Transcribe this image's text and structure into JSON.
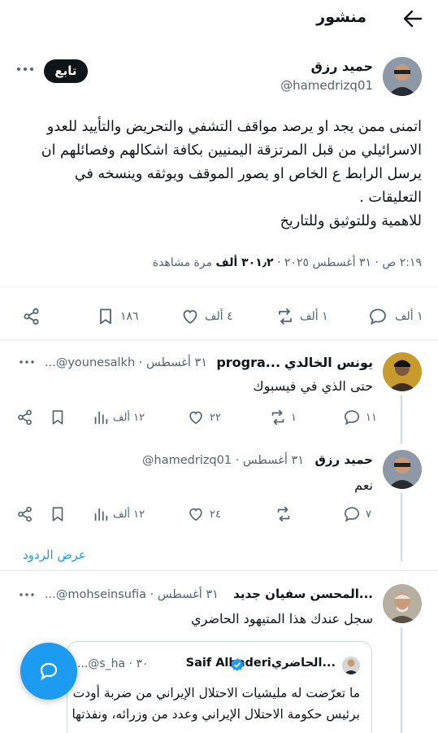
{
  "header": {
    "title": "منشور"
  },
  "post": {
    "author_name": "حميد رزق",
    "author_handle": "@hamedrizq01",
    "follow_label": "تابع",
    "text_lines": [
      "اتمنى ممن يجد او يرصد مواقف التشفي والتحريض والتأييد  للعدو",
      "الاسرائيلي من قبل المرتزقة اليمنيين بكافة اشكالهم وفصائلهم ان",
      "يرسل الرابط ع الخاص او يصور الموقف  ويوثقه وينسخه في",
      "التعليقات .",
      "للاهمية وللتوثيق وللتاريخ"
    ],
    "meta_time": "٢:١٩ ص · ٣١ أغسطس ٢٠٢٥ · ",
    "meta_views_count": "٣٠١٫٢ ألف",
    "meta_views_label": " مرة مشاهدة",
    "actions": {
      "replies": "١ ألف",
      "reposts": "١ ألف",
      "likes": "٤ ألف",
      "bookmarks": "١٨٦"
    }
  },
  "replies": [
    {
      "author_name": "يونس الخالدي",
      "author_extra": "...progra",
      "handle_date": "...@younesalkh · ٣١ أغسطس",
      "text": "حتى الذي في فيسبوك",
      "actions": {
        "replies": "١١",
        "reposts": "١",
        "likes": "٢٢",
        "views": "١٢ ألف"
      }
    },
    {
      "author_name": "حميد رزق",
      "handle_date": "@hamedrizq01 · ٣١ أغسطس",
      "text": "نعم",
      "actions": {
        "replies": "٧",
        "reposts": "",
        "likes": "٢٤",
        "views": "١٢ ألف"
      }
    }
  ],
  "show_replies_label": "عرض الردود",
  "reply3": {
    "author_name": "...المحسن سفيان جديد",
    "handle_date": "...@mohseinsufia · ٣١ أغسطس",
    "text": "سجل عندك هذا المتيهود الحاضري",
    "quote": {
      "author_name": "Saif Alhaderi",
      "author_extra": "...الحاضري",
      "handle_date": "...@s_ha · ٣٠",
      "text_lines": [
        "ما تعرّضت له مليشيات الاحتلال الإيراني من ضربة أودت",
        "برئيس حكومة الاحتلال الإيراني وعدد من وزرائه، ونفذتها"
      ]
    }
  },
  "colors": {
    "accent": "#1d9bf0",
    "text": "#0f1419",
    "muted": "#536471",
    "verified": "#1d9bf0"
  }
}
